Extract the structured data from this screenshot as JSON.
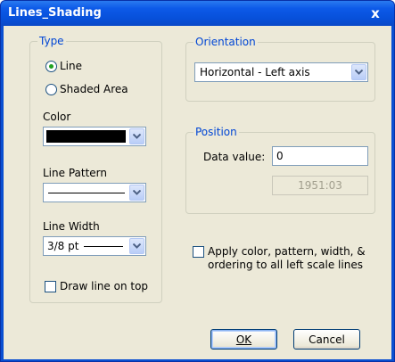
{
  "window": {
    "title": "Lines_Shading",
    "close_symbol": "x"
  },
  "type_group": {
    "legend": "Type",
    "radio_line": "Line",
    "radio_shaded": "Shaded Area",
    "color_label": "Color",
    "color_value": "#000000",
    "line_pattern_label": "Line Pattern",
    "line_width_label": "Line Width",
    "line_width_value": "3/8 pt",
    "draw_on_top_label": "Draw line on top"
  },
  "orientation_group": {
    "legend": "Orientation",
    "value": "Horizontal - Left axis"
  },
  "position_group": {
    "legend": "Position",
    "data_value_label": "Data value:",
    "data_value": "0",
    "date_value": "1951:03"
  },
  "apply_all": {
    "line1": "Apply color, pattern, width, &",
    "line2": "ordering to all left scale lines"
  },
  "buttons": {
    "ok": "OK",
    "cancel": "Cancel"
  },
  "icons": [
    "radio-selected-icon",
    "radio-unselected-icon",
    "chevron-down-icon",
    "checkbox-icon",
    "close-icon"
  ],
  "colors": {
    "titlebar": "#0a4fd1",
    "face": "#ece9d8",
    "group_label": "#0046d5"
  }
}
